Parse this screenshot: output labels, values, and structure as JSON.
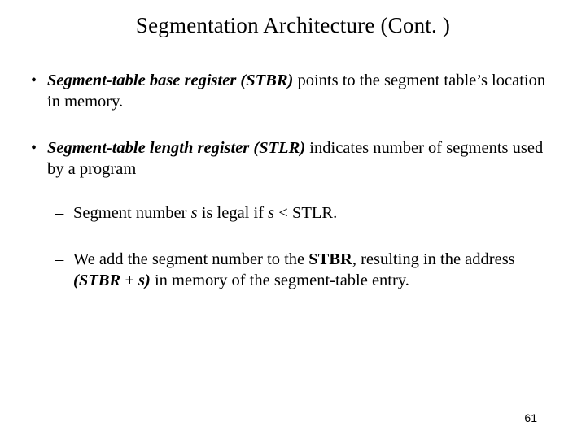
{
  "title": "Segmentation Architecture (Cont. )",
  "bullets": {
    "b1": {
      "term": "Segment-table base register (STBR)",
      "rest": " points to the segment table’s location in memory."
    },
    "b2": {
      "term": "Segment-table length register (STLR)",
      "rest": " indicates number of segments used by a program"
    },
    "sub1": {
      "t1": "Segment number ",
      "s1": "s",
      "t2": " is legal if ",
      "s2": "s",
      "t3": " < STLR."
    },
    "sub2": {
      "t1": "We add the segment number to the ",
      "stbr": "STBR",
      "t2": ", resulting in the address ",
      "expr": "(STBR + s)",
      "t3": " in memory of the segment-table entry."
    }
  },
  "page_number": "61"
}
